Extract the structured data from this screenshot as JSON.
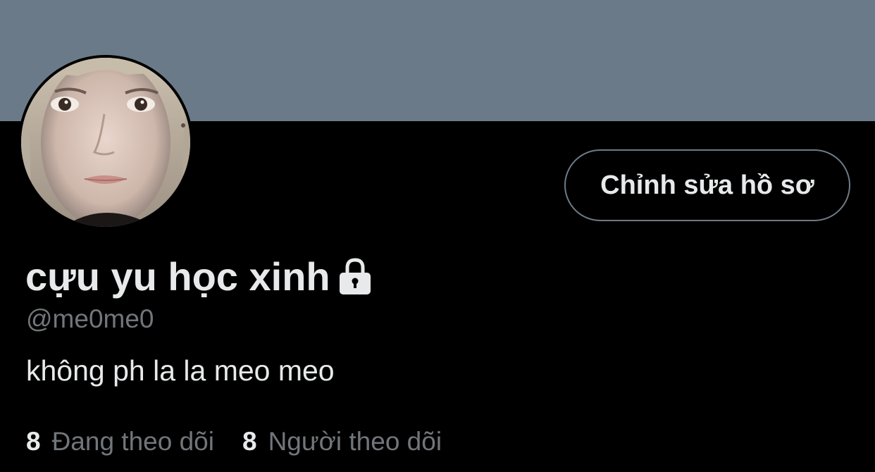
{
  "profile": {
    "banner_color": "#6b7a89",
    "avatar_icon": "avatar",
    "edit_button_label": "Chỉnh sửa hồ sơ",
    "display_name": "cựu yu học xinh",
    "protected_icon": "lock-icon",
    "handle": "@me0me0",
    "bio": "không ph la la meo meo"
  },
  "stats": {
    "following": {
      "count": "8",
      "label": "Đang theo dõi"
    },
    "followers": {
      "count": "8",
      "label": "Người theo dõi"
    }
  },
  "colors": {
    "background": "#000000",
    "primary_text": "#e7e9ea",
    "secondary_text": "#71767b",
    "button_border": "#6e7b87"
  }
}
